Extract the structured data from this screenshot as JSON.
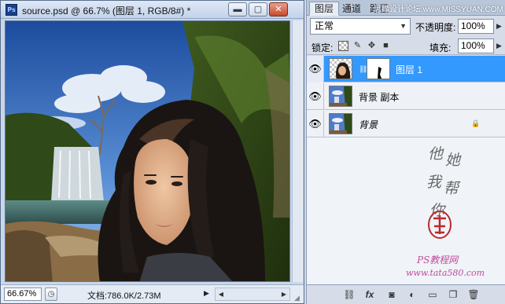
{
  "document": {
    "title": "source.psd @ 66.7% (图层 1, RGB/8#) *",
    "app_icon": "Ps",
    "window_buttons": {
      "minimize": "▬",
      "restore": "▢",
      "close": "✕"
    },
    "zoom": "66.67%",
    "doc_info": "文档:786.0K/2.73M",
    "status_menu_arrow": "▶"
  },
  "panel": {
    "tabs": [
      "图层",
      "通道",
      "路径"
    ],
    "active_tab": "图层",
    "watermark_top": "思缘设计论坛 www.MISSYUAN.COM",
    "blend_mode": "正常",
    "opacity_label": "不透明度:",
    "opacity_value": "100%",
    "lock_label": "锁定:",
    "fill_label": "填充:",
    "fill_value": "100%",
    "layers": [
      {
        "name": "图层 1",
        "selected": true,
        "has_mask": true
      },
      {
        "name": "背景 副本",
        "selected": false
      },
      {
        "name": "背景",
        "selected": false,
        "locked": true,
        "italic": true
      }
    ],
    "calligraphy": [
      "他",
      "她",
      "我",
      "帮",
      "你"
    ],
    "seal_text": "",
    "watermark_ps": "PS教程网",
    "watermark_url": "www.tata580.com",
    "bottom_icons": [
      "link-layers-icon",
      "fx-icon",
      "add-mask-icon",
      "adjustment-layer-icon",
      "group-folder-icon",
      "new-layer-icon",
      "trash-icon"
    ]
  },
  "colors": {
    "selected_layer": "#3399ff",
    "panel_bg": "#d6dde9"
  }
}
